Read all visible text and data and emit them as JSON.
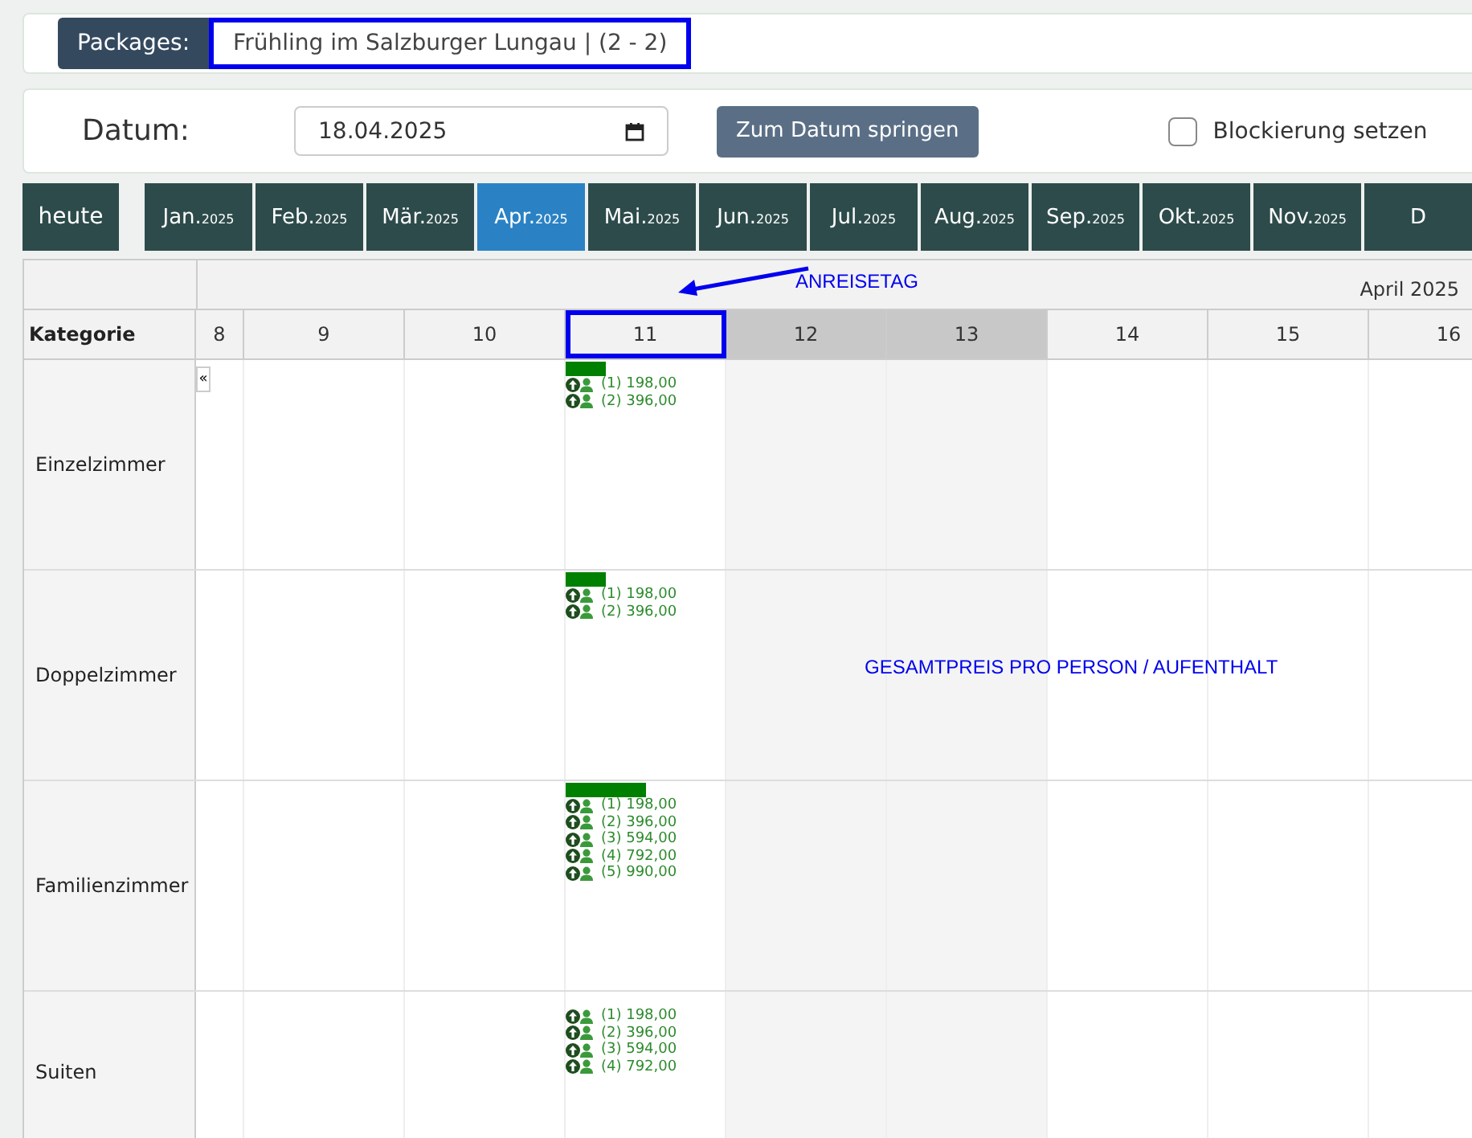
{
  "package": {
    "label": "Packages:",
    "value": "Frühling im Salzburger Lungau | (2 - 2)",
    "highlighted": true
  },
  "date": {
    "label": "Datum:",
    "value": "18.04.2025"
  },
  "jump_button": "Zum Datum springen",
  "block": {
    "label": "Blockierung setzen",
    "checked": false
  },
  "today_button": "heute",
  "months": [
    {
      "name": "Jan.",
      "year": "2025",
      "selected": false
    },
    {
      "name": "Feb.",
      "year": "2025",
      "selected": false
    },
    {
      "name": "Mär.",
      "year": "2025",
      "selected": false
    },
    {
      "name": "Apr.",
      "year": "2025",
      "selected": true
    },
    {
      "name": "Mai.",
      "year": "2025",
      "selected": false
    },
    {
      "name": "Jun.",
      "year": "2025",
      "selected": false
    },
    {
      "name": "Jul.",
      "year": "2025",
      "selected": false
    },
    {
      "name": "Aug.",
      "year": "2025",
      "selected": false
    },
    {
      "name": "Sep.",
      "year": "2025",
      "selected": false
    },
    {
      "name": "Okt.",
      "year": "2025",
      "selected": false
    },
    {
      "name": "Nov.",
      "year": "2025",
      "selected": false
    },
    {
      "name": "D",
      "selected": false
    }
  ],
  "calendar": {
    "month_title": "April 2025",
    "category_header": "Kategorie",
    "collapse_button": "«",
    "days": [
      {
        "label": "8",
        "weekend": false,
        "arrival": false
      },
      {
        "label": "9",
        "weekend": false,
        "arrival": false
      },
      {
        "label": "10",
        "weekend": false,
        "arrival": false
      },
      {
        "label": "11",
        "weekend": false,
        "arrival": true
      },
      {
        "label": "12",
        "weekend": true,
        "arrival": false
      },
      {
        "label": "13",
        "weekend": true,
        "arrival": false
      },
      {
        "label": "14",
        "weekend": false,
        "arrival": false
      },
      {
        "label": "15",
        "weekend": false,
        "arrival": false
      },
      {
        "label": "16",
        "weekend": false,
        "arrival": false
      }
    ],
    "rows": [
      {
        "name": "Einzelzimmer",
        "kind": "short",
        "prices": [
          "(1) 198,00",
          "(2) 396,00"
        ]
      },
      {
        "name": "Doppelzimmer",
        "kind": "short",
        "prices": [
          "(1) 198,00",
          "(2) 396,00"
        ]
      },
      {
        "name": "Familienzimmer",
        "kind": "long",
        "prices": [
          "(1) 198,00",
          "(2) 396,00",
          "(3) 594,00",
          "(4) 792,00",
          "(5) 990,00"
        ]
      },
      {
        "name": "Suiten",
        "kind": "plain",
        "prices": [
          "(1) 198,00",
          "(2) 396,00",
          "(3) 594,00",
          "(4) 792,00"
        ]
      }
    ]
  },
  "annotations": {
    "arrival": "ANREISETAG",
    "total": "GESAMTPREIS PRO PERSON / AUFENTHALT"
  }
}
